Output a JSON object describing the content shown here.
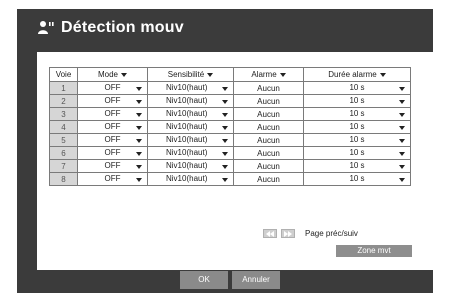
{
  "title": "Détection mouv",
  "columns": {
    "voie": "Voie",
    "mode": "Mode",
    "sensibilite": "Sensibilité",
    "alarme": "Alarme",
    "duree": "Durée alarme"
  },
  "rows": [
    {
      "ch": "1",
      "mode": "OFF",
      "sens": "Niv10(haut)",
      "alarm": "Aucun",
      "dur": "10 s"
    },
    {
      "ch": "2",
      "mode": "OFF",
      "sens": "Niv10(haut)",
      "alarm": "Aucun",
      "dur": "10 s"
    },
    {
      "ch": "3",
      "mode": "OFF",
      "sens": "Niv10(haut)",
      "alarm": "Aucun",
      "dur": "10 s"
    },
    {
      "ch": "4",
      "mode": "OFF",
      "sens": "Niv10(haut)",
      "alarm": "Aucun",
      "dur": "10 s"
    },
    {
      "ch": "5",
      "mode": "OFF",
      "sens": "Niv10(haut)",
      "alarm": "Aucun",
      "dur": "10 s"
    },
    {
      "ch": "6",
      "mode": "OFF",
      "sens": "Niv10(haut)",
      "alarm": "Aucun",
      "dur": "10 s"
    },
    {
      "ch": "7",
      "mode": "OFF",
      "sens": "Niv10(haut)",
      "alarm": "Aucun",
      "dur": "10 s"
    },
    {
      "ch": "8",
      "mode": "OFF",
      "sens": "Niv10(haut)",
      "alarm": "Aucun",
      "dur": "10 s"
    }
  ],
  "pager_label": "Page préc/suiv",
  "zone_button": "Zone mvt",
  "ok_button": "OK",
  "cancel_button": "Annuler",
  "icons": {
    "title": "user-motion-icon",
    "prev_page": "rewind-icon",
    "next_page": "fast-forward-icon",
    "dropdown": "caret-down-icon"
  },
  "colors": {
    "window_bg": "#3b3b3b",
    "panel_bg": "#ffffff",
    "channel_cell": "#d6d6d6",
    "button_bg": "#8a8a8a"
  }
}
